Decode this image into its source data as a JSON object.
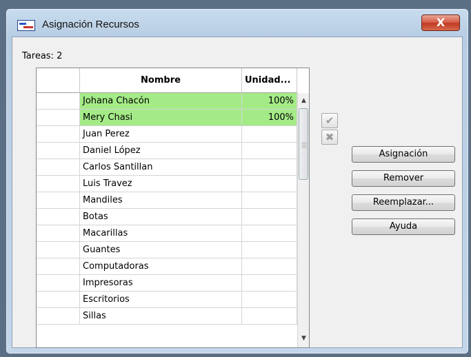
{
  "window": {
    "title": "Asignación Recursos",
    "close_symbol": "X"
  },
  "tareas_label": "Tareas: 2",
  "grid": {
    "columns": [
      "Nombre",
      "Unidad..."
    ],
    "rows": [
      {
        "nombre": "Johana Chacón",
        "unidad": "100%",
        "assigned": true
      },
      {
        "nombre": "Mery Chasi",
        "unidad": "100%",
        "assigned": true
      },
      {
        "nombre": "Juan Perez",
        "unidad": "",
        "assigned": false
      },
      {
        "nombre": "Daniel López",
        "unidad": "",
        "assigned": false
      },
      {
        "nombre": "Carlos Santillan",
        "unidad": "",
        "assigned": false
      },
      {
        "nombre": "Luis Travez",
        "unidad": "",
        "assigned": false
      },
      {
        "nombre": "Mandiles",
        "unidad": "",
        "assigned": false
      },
      {
        "nombre": "Botas",
        "unidad": "",
        "assigned": false
      },
      {
        "nombre": "Macarillas",
        "unidad": "",
        "assigned": false
      },
      {
        "nombre": "Guantes",
        "unidad": "",
        "assigned": false
      },
      {
        "nombre": "Computadoras",
        "unidad": "",
        "assigned": false
      },
      {
        "nombre": "Impresoras",
        "unidad": "",
        "assigned": false
      },
      {
        "nombre": "Escritorios",
        "unidad": "",
        "assigned": false
      },
      {
        "nombre": "Sillas",
        "unidad": "",
        "assigned": false
      }
    ]
  },
  "side_icons": {
    "accept": "check-icon",
    "cancel": "x-mark-icon"
  },
  "buttons": {
    "asignacion": "Asignación",
    "remover": "Remover",
    "reemplazar": "Reemplazar...",
    "ayuda": "Ayuda"
  },
  "colors": {
    "assigned_row": "#a4eb88",
    "close_button": "#c8412a"
  }
}
